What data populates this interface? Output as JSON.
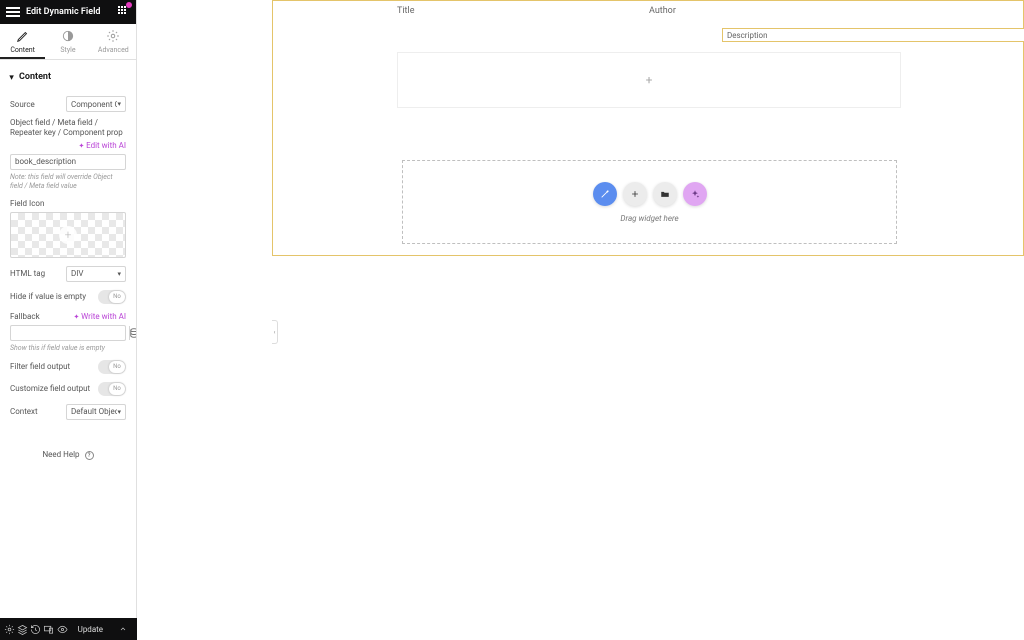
{
  "header": {
    "title": "Edit Dynamic Field"
  },
  "tabs": {
    "content": "Content",
    "style": "Style",
    "advanced": "Advanced"
  },
  "section": {
    "title": "Content"
  },
  "source": {
    "label": "Source",
    "value": "Component Co"
  },
  "object_field": {
    "label": "Object field / Meta field / Repeater key / Component prop",
    "ai_link": "Edit with AI",
    "value": "book_description",
    "note": "Note: this field will override Object field / Meta field value"
  },
  "field_icon": {
    "label": "Field Icon"
  },
  "html_tag": {
    "label": "HTML tag",
    "value": "DIV"
  },
  "hide_empty": {
    "label": "Hide if value is empty",
    "value": "No"
  },
  "fallback": {
    "label": "Fallback",
    "ai_link": "Write with AI",
    "hint": "Show this if field value is empty"
  },
  "filter": {
    "label": "Filter field output",
    "value": "No"
  },
  "customize": {
    "label": "Customize field output",
    "value": "No"
  },
  "context": {
    "label": "Context",
    "value": "Default Object"
  },
  "help": {
    "label": "Need Help"
  },
  "footer": {
    "update": "Update"
  },
  "canvas": {
    "col_title": "Title",
    "col_author": "Author",
    "description": "Description",
    "drop": "Drag widget here"
  }
}
